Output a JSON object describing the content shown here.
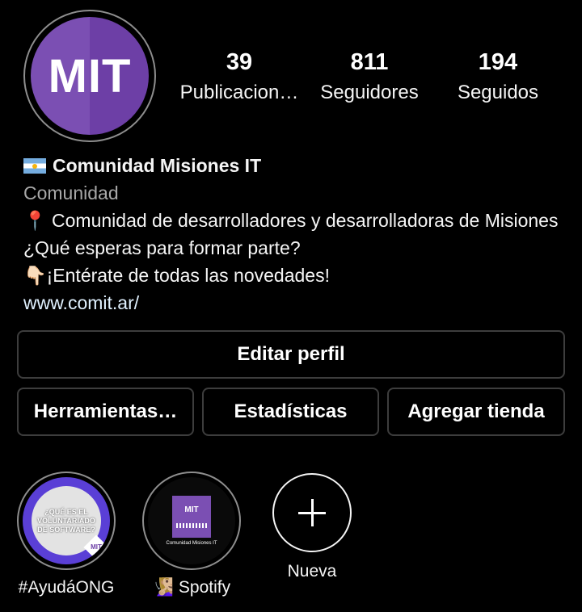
{
  "profile": {
    "avatar_text": "MIT",
    "stats": [
      {
        "value": "39",
        "label": "Publicacion…"
      },
      {
        "value": "811",
        "label": "Seguidores"
      },
      {
        "value": "194",
        "label": "Seguidos"
      }
    ],
    "name": "Comunidad Misiones IT",
    "flag_icon": "argentina-flag-icon",
    "category": "Comunidad",
    "bio_line1": "📍 Comunidad de desarrolladores y desarrolladoras de Misiones ¿Qué esperas para formar parte?",
    "bio_line2": "👇🏻¡Entérate de todas las novedades!",
    "link": "www.comit.ar/"
  },
  "buttons": {
    "edit_profile": "Editar perfil",
    "tools": "Herramientas…",
    "stats": "Estadísticas",
    "add_shop": "Agregar tienda"
  },
  "highlights": [
    {
      "label": "#AyudáONG",
      "cover_text": "¿QUÉ ES EL VOLUNTARIADO DE SOFTWARE?",
      "badge": "MIT"
    },
    {
      "label": "🧏🏼‍♀️ Spotify",
      "cover_text": "MIT",
      "cover_caption": "Comunidad Misiones IT"
    },
    {
      "label": "Nueva",
      "icon": "plus-icon"
    }
  ],
  "colors": {
    "background": "#000000",
    "avatar_purple": "#7b4fb3",
    "button_border": "#3d3d3d",
    "link": "#e0f1ff",
    "muted": "#a8a8a8"
  }
}
